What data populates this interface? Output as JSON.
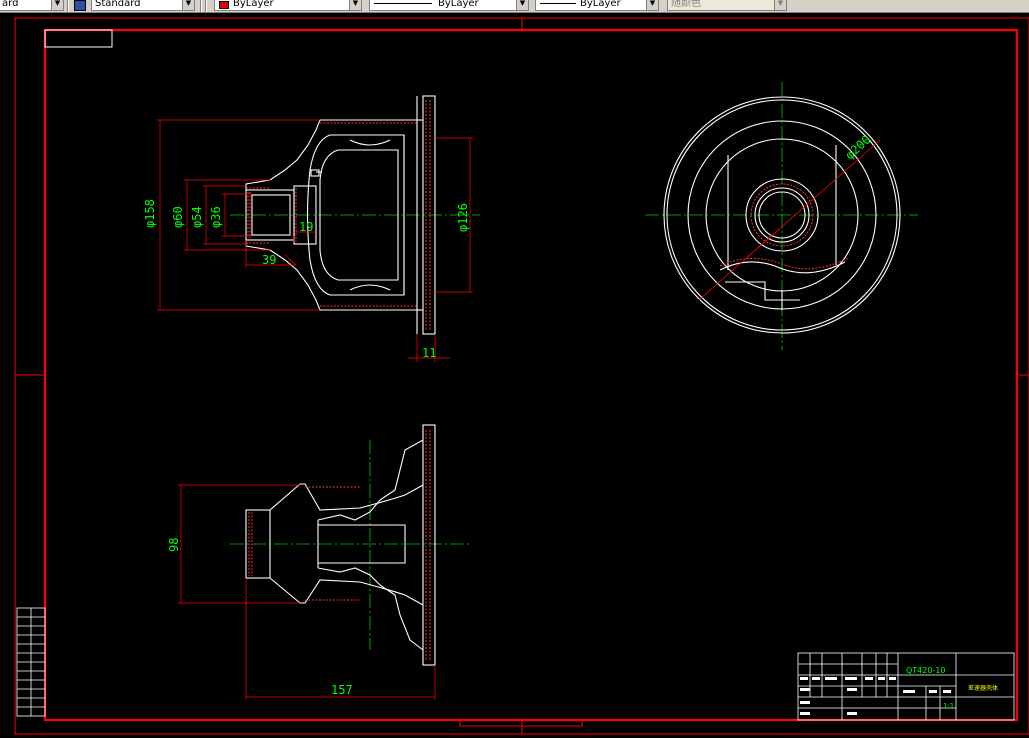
{
  "toolbar": {
    "text_style_fragment": "ard",
    "dim_style": "Standard",
    "layer_color": "ByLayer",
    "linetype": "ByLayer",
    "lineweight": "ByLayer",
    "plot_style": "随颜色",
    "colors": {
      "layer_swatch": "#e00000",
      "toolbar_bg": "#d4d0c8"
    }
  },
  "dimensions": {
    "d158": "φ158",
    "d60": "φ60",
    "d54": "φ54",
    "d36": "φ36",
    "d126": "φ126",
    "d200": "φ200",
    "l19": "19",
    "l39": "39",
    "l11": "11",
    "l98": "98",
    "l157": "157"
  },
  "title_block": {
    "material": "QT420-10",
    "name": "差速器壳体",
    "scale": "1:1"
  },
  "colors": {
    "border": "#ff0000",
    "geometry": "#ffffff",
    "hidden": "#ff3030",
    "dimension": "#00ff00",
    "center": "#00cc00",
    "background": "#000000"
  }
}
